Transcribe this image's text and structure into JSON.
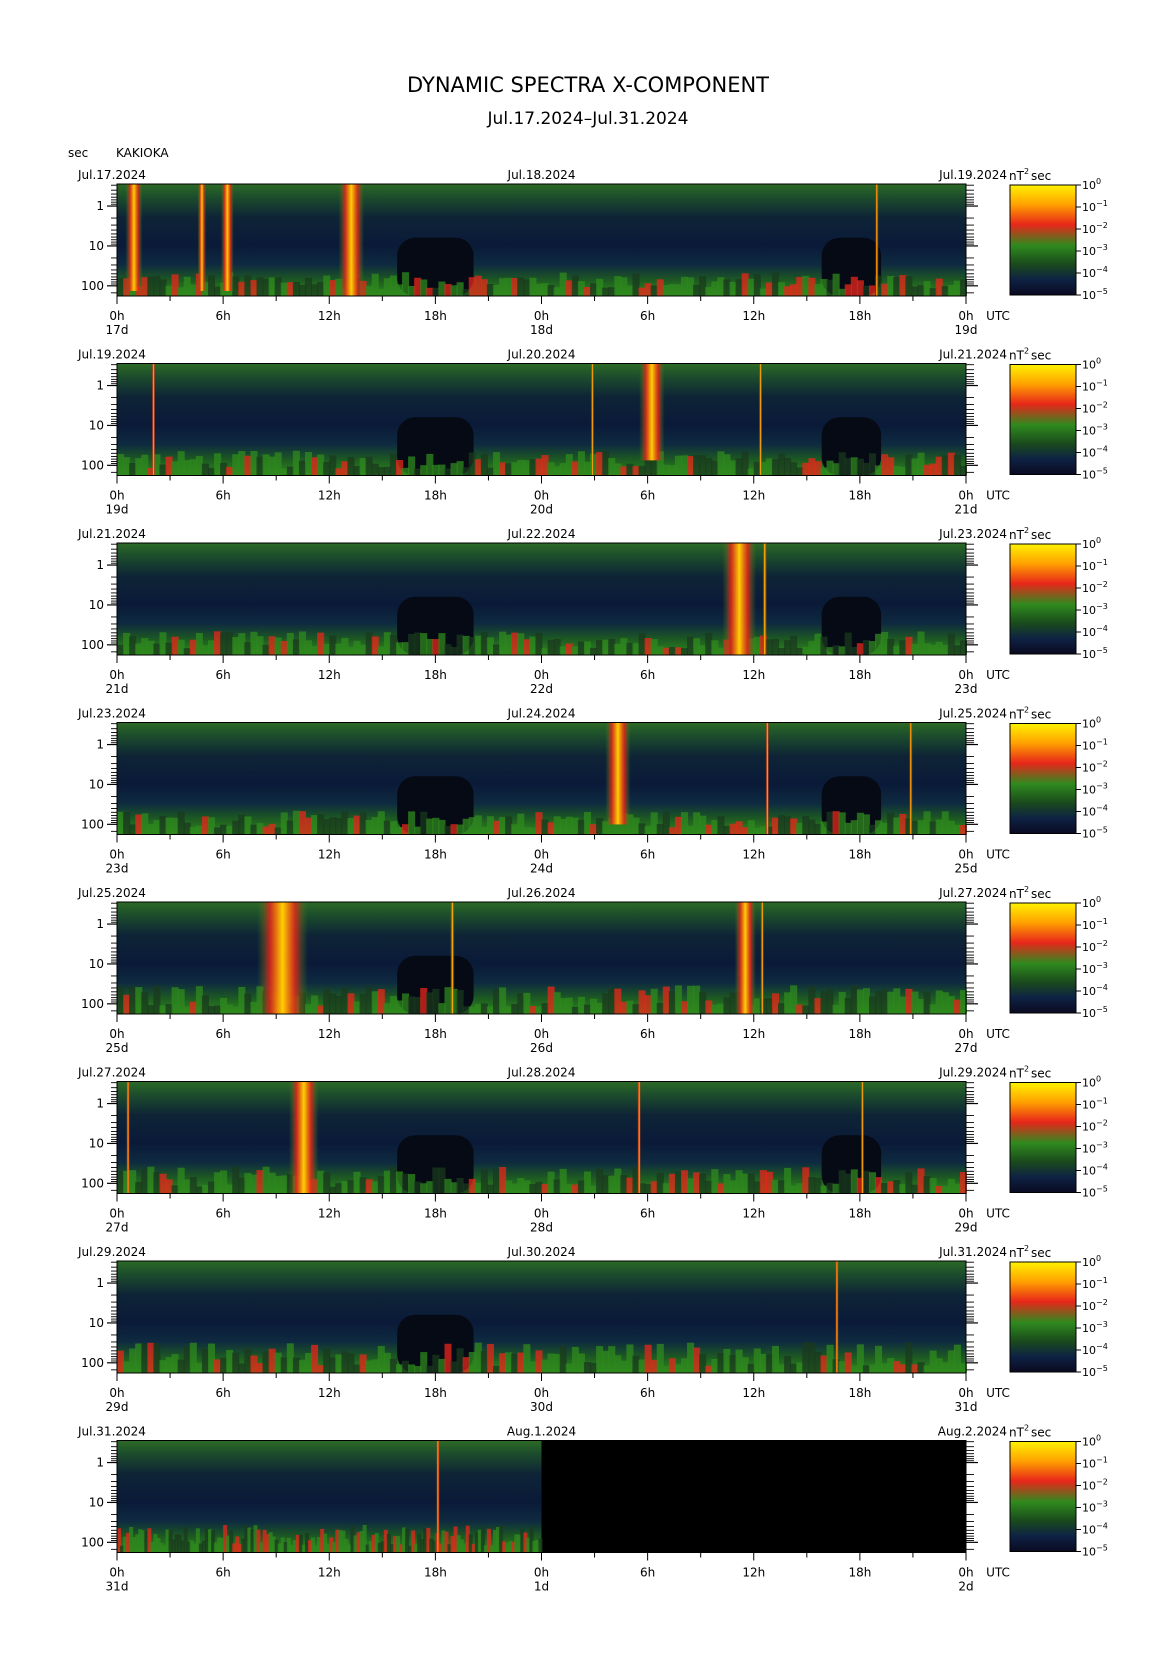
{
  "title": "DYNAMIC SPECTRA X-COMPONENT",
  "subtitle": "Jul.17.2024–Jul.31.2024",
  "y_unit": "sec",
  "station": "KAKIOKA",
  "colorbar_unit": "nT",
  "colorbar_unit_exp": "2",
  "colorbar_unit_tail": "sec",
  "time_zone": "UTC",
  "colors": {
    "background": "#0a1428",
    "low": "#1a3a1e",
    "mid": "#2f8a1e",
    "high": "#e8261a",
    "peak": "#ffe000"
  },
  "chart_data": {
    "type": "heatmap",
    "x_ticks": [
      "0h",
      "6h",
      "12h",
      "18h",
      "0h",
      "6h",
      "12h",
      "18h",
      "0h"
    ],
    "y_ticks": [
      "1",
      "10",
      "100"
    ],
    "y_scale": "log",
    "colorbar_ticks": [
      {
        "base": "10",
        "exp": "0"
      },
      {
        "base": "10",
        "exp": "−1"
      },
      {
        "base": "10",
        "exp": "−2"
      },
      {
        "base": "10",
        "exp": "−3"
      },
      {
        "base": "10",
        "exp": "−4"
      },
      {
        "base": "10",
        "exp": "−5"
      }
    ],
    "panels": [
      {
        "date_left": "Jul.17.2024",
        "date_mid": "Jul.18.2024",
        "date_right": "Jul.19.2024",
        "day_left": "17d",
        "day_mid": "18d",
        "day_right": "19d",
        "events": [
          {
            "t": 0.02,
            "w": 0.02,
            "s": 0.9
          },
          {
            "t": 0.1,
            "w": 0.01,
            "s": 0.9
          },
          {
            "t": 0.13,
            "w": 0.015,
            "s": 0.9
          },
          {
            "t": 0.276,
            "w": 0.03,
            "s": 1.0
          },
          {
            "t": 0.895,
            "w": 0.004,
            "s": 1.0
          }
        ],
        "quiet": [
          [
            0.33,
            0.42
          ],
          [
            0.83,
            0.9
          ]
        ],
        "base": 0.35,
        "data_end": 1.0
      },
      {
        "date_left": "Jul.19.2024",
        "date_mid": "Jul.20.2024",
        "date_right": "Jul.21.2024",
        "day_left": "19d",
        "day_mid": "20d",
        "day_right": "21d",
        "events": [
          {
            "t": 0.043,
            "w": 0.004,
            "s": 1.0
          },
          {
            "t": 0.56,
            "w": 0.004,
            "s": 1.0
          },
          {
            "t": 0.63,
            "w": 0.03,
            "s": 0.7
          },
          {
            "t": 0.758,
            "w": 0.004,
            "s": 1.0
          }
        ],
        "quiet": [
          [
            0.33,
            0.42
          ],
          [
            0.83,
            0.9
          ]
        ],
        "base": 0.4,
        "data_end": 1.0
      },
      {
        "date_left": "Jul.21.2024",
        "date_mid": "Jul.22.2024",
        "date_right": "Jul.23.2024",
        "day_left": "21d",
        "day_mid": "22d",
        "day_right": "23d",
        "events": [
          {
            "t": 0.733,
            "w": 0.04,
            "s": 1.0
          },
          {
            "t": 0.763,
            "w": 0.005,
            "s": 1.0
          }
        ],
        "quiet": [
          [
            0.33,
            0.42
          ],
          [
            0.83,
            0.9
          ]
        ],
        "base": 0.35,
        "data_end": 1.0
      },
      {
        "date_left": "Jul.23.2024",
        "date_mid": "Jul.24.2024",
        "date_right": "Jul.25.2024",
        "day_left": "23d",
        "day_mid": "24d",
        "day_right": "25d",
        "events": [
          {
            "t": 0.59,
            "w": 0.03,
            "s": 0.8
          },
          {
            "t": 0.766,
            "w": 0.004,
            "s": 1.0
          },
          {
            "t": 0.935,
            "w": 0.004,
            "s": 1.0
          }
        ],
        "quiet": [
          [
            0.33,
            0.42
          ],
          [
            0.83,
            0.9
          ]
        ],
        "base": 0.35,
        "data_end": 1.0
      },
      {
        "date_left": "Jul.25.2024",
        "date_mid": "Jul.26.2024",
        "date_right": "Jul.27.2024",
        "day_left": "25d",
        "day_mid": "26d",
        "day_right": "27d",
        "events": [
          {
            "t": 0.195,
            "w": 0.06,
            "s": 1.0
          },
          {
            "t": 0.395,
            "w": 0.005,
            "s": 1.0
          },
          {
            "t": 0.74,
            "w": 0.025,
            "s": 1.0
          },
          {
            "t": 0.76,
            "w": 0.004,
            "s": 1.0
          }
        ],
        "quiet": [
          [
            0.33,
            0.42
          ]
        ],
        "base": 0.6,
        "data_end": 1.0
      },
      {
        "date_left": "Jul.27.2024",
        "date_mid": "Jul.28.2024",
        "date_right": "Jul.29.2024",
        "day_left": "27d",
        "day_mid": "28d",
        "day_right": "29d",
        "events": [
          {
            "t": 0.013,
            "w": 0.004,
            "s": 1.0
          },
          {
            "t": 0.22,
            "w": 0.035,
            "s": 1.0
          },
          {
            "t": 0.615,
            "w": 0.004,
            "s": 1.0
          },
          {
            "t": 0.878,
            "w": 0.004,
            "s": 1.0
          }
        ],
        "quiet": [
          [
            0.33,
            0.42
          ],
          [
            0.83,
            0.9
          ]
        ],
        "base": 0.5,
        "data_end": 1.0
      },
      {
        "date_left": "Jul.29.2024",
        "date_mid": "Jul.30.2024",
        "date_right": "Jul.31.2024",
        "day_left": "29d",
        "day_mid": "30d",
        "day_right": "31d",
        "events": [
          {
            "t": 0.848,
            "w": 0.004,
            "s": 1.0
          }
        ],
        "quiet": [
          [
            0.33,
            0.42
          ]
        ],
        "base": 0.7,
        "data_end": 1.0
      },
      {
        "date_left": "Jul.31.2024",
        "date_mid": "Aug.1.2024",
        "date_right": "Aug.2.2024",
        "day_left": "31d",
        "day_mid": "1d",
        "day_right": "2d",
        "events": [
          {
            "t": 0.378,
            "w": 0.004,
            "s": 1.0
          }
        ],
        "quiet": [],
        "base": 0.55,
        "data_end": 0.5
      }
    ]
  }
}
